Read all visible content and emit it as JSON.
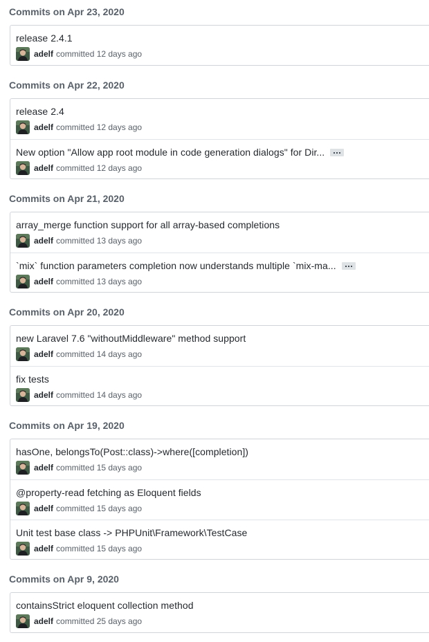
{
  "groups": [
    {
      "heading": "Commits on Apr 23, 2020",
      "commits": [
        {
          "title": "release 2.4.1",
          "author": "adelf",
          "committed": "committed 12 days ago",
          "has_ellipsis": false
        }
      ]
    },
    {
      "heading": "Commits on Apr 22, 2020",
      "commits": [
        {
          "title": "release 2.4",
          "author": "adelf",
          "committed": "committed 12 days ago",
          "has_ellipsis": false
        },
        {
          "title": "New option \"Allow app root module in code generation dialogs\" for Dir...",
          "author": "adelf",
          "committed": "committed 12 days ago",
          "has_ellipsis": true
        }
      ]
    },
    {
      "heading": "Commits on Apr 21, 2020",
      "commits": [
        {
          "title": "array_merge function support for all array-based completions",
          "author": "adelf",
          "committed": "committed 13 days ago",
          "has_ellipsis": false
        },
        {
          "title": "`mix` function parameters completion now understands multiple `mix-ma...",
          "author": "adelf",
          "committed": "committed 13 days ago",
          "has_ellipsis": true
        }
      ]
    },
    {
      "heading": "Commits on Apr 20, 2020",
      "commits": [
        {
          "title": "new Laravel 7.6 \"withoutMiddleware\" method support",
          "author": "adelf",
          "committed": "committed 14 days ago",
          "has_ellipsis": false
        },
        {
          "title": "fix tests",
          "author": "adelf",
          "committed": "committed 14 days ago",
          "has_ellipsis": false
        }
      ]
    },
    {
      "heading": "Commits on Apr 19, 2020",
      "commits": [
        {
          "title": "hasOne, belongsTo(Post::class)->where([completion])",
          "author": "adelf",
          "committed": "committed 15 days ago",
          "has_ellipsis": false
        },
        {
          "title": "@property-read fetching as Eloquent fields",
          "author": "adelf",
          "committed": "committed 15 days ago",
          "has_ellipsis": false
        },
        {
          "title": "Unit test base class -> PHPUnit\\Framework\\TestCase",
          "author": "adelf",
          "committed": "committed 15 days ago",
          "has_ellipsis": false
        }
      ]
    },
    {
      "heading": "Commits on Apr 9, 2020",
      "commits": [
        {
          "title": "containsStrict eloquent collection method",
          "author": "adelf",
          "committed": "committed 25 days ago",
          "has_ellipsis": false
        }
      ]
    }
  ],
  "icons": {
    "avatar": "avatar-icon",
    "ellipsis": "ellipsis-icon"
  },
  "colors": {
    "heading": "#586069",
    "title": "#24292e",
    "border": "#d1d5da",
    "ellipsis_bg": "#dfe2e5"
  }
}
